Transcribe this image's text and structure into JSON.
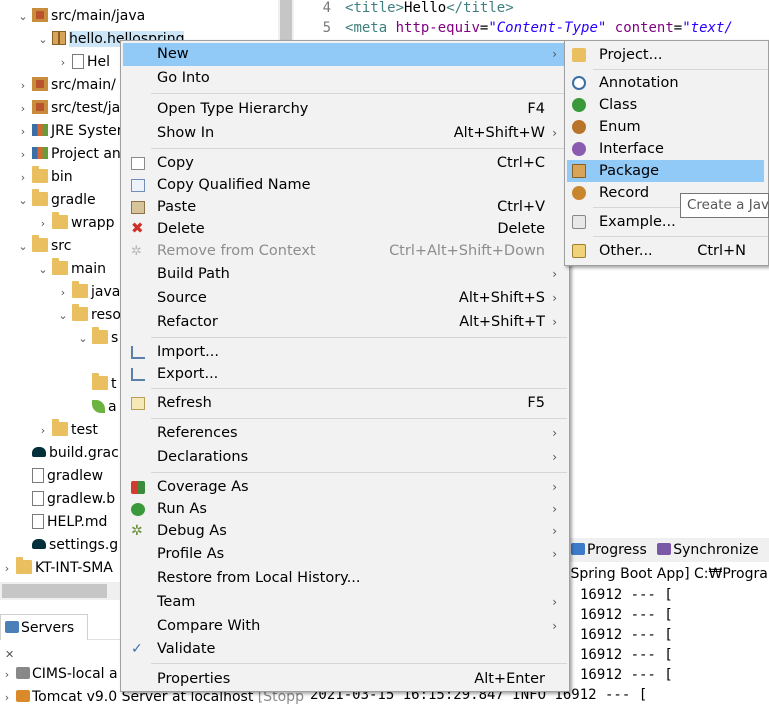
{
  "editor": {
    "lines": [
      {
        "number": "4",
        "open": "<",
        "tag": "title",
        "close": ">",
        "text": "Hello",
        "end": "</title>"
      },
      {
        "number": "5",
        "open": "<",
        "tag": "meta",
        "attr1": "http-equiv",
        "eq1": "=",
        "val1": "\"Content-Type\"",
        "attr2": "content",
        "eq2": "=",
        "val2": "\"text/"
      }
    ]
  },
  "explorer": {
    "rows": [
      {
        "label": "src/main/java",
        "icon": "source-folder-icon"
      },
      {
        "label": "hello.hellospring",
        "icon": "package-icon"
      },
      {
        "label": "Hel",
        "icon": "java-file-icon"
      },
      {
        "label": "src/main/",
        "icon": "source-folder-icon"
      },
      {
        "label": "src/test/ja",
        "icon": "source-folder-icon"
      },
      {
        "label": "JRE Syster",
        "icon": "library-icon"
      },
      {
        "label": "Project an",
        "icon": "library-icon"
      },
      {
        "label": "bin",
        "icon": "folder-icon"
      },
      {
        "label": "gradle",
        "icon": "folder-icon"
      },
      {
        "label": "wrapp",
        "icon": "folder-icon"
      },
      {
        "label": "src",
        "icon": "folder-icon"
      },
      {
        "label": "main",
        "icon": "folder-icon"
      },
      {
        "label": "java",
        "icon": "folder-icon"
      },
      {
        "label": "reso",
        "icon": "folder-icon"
      },
      {
        "label": "s",
        "icon": "folder-icon"
      },
      {
        "label": "t",
        "icon": "folder-icon"
      },
      {
        "label": "a",
        "icon": "spring-leaf-icon"
      },
      {
        "label": "test",
        "icon": "folder-icon"
      },
      {
        "label": "build.grac",
        "icon": "gradle-icon"
      },
      {
        "label": "gradlew",
        "icon": "file-icon"
      },
      {
        "label": "gradlew.b",
        "icon": "file-icon"
      },
      {
        "label": "HELP.md",
        "icon": "markdown-file-icon"
      },
      {
        "label": "settings.g",
        "icon": "gradle-icon"
      },
      {
        "label": "KT-INT-SMA",
        "icon": "project-icon"
      }
    ]
  },
  "servers": {
    "tab_label": "Servers",
    "rows": [
      {
        "label": "CIMS-local a",
        "status": ""
      },
      {
        "label": "Tomcat v9.0 Server at localhost",
        "status": "[Stopp"
      }
    ]
  },
  "console": {
    "tabs": [
      {
        "label": "Progress",
        "icon": "progress-icon"
      },
      {
        "label": "Synchronize",
        "icon": "synchronize-icon"
      }
    ],
    "header": "[Spring Boot App] C:₩Progra",
    "lines": [
      {
        "text": "16912 --- ["
      },
      {
        "text": "16912 --- ["
      },
      {
        "text": "16912 --- ["
      },
      {
        "text": "16912 --- ["
      },
      {
        "text": "16912 --- ["
      },
      {
        "text": "2021-03-15 16:15:29.847  INFO 16912 --- ["
      }
    ]
  },
  "context_menu": {
    "items": [
      {
        "label": "New",
        "shortcut": "",
        "submenu": true,
        "disabled": false,
        "highlighted": true,
        "icon": ""
      },
      {
        "label": "Go Into",
        "shortcut": "",
        "submenu": false,
        "disabled": false,
        "icon": ""
      },
      {
        "label": "Open Type Hierarchy",
        "shortcut": "F4",
        "submenu": false,
        "disabled": false,
        "icon": ""
      },
      {
        "label": "Show In",
        "shortcut": "Alt+Shift+W",
        "submenu": true,
        "disabled": false,
        "icon": ""
      },
      {
        "label": "Copy",
        "shortcut": "Ctrl+C",
        "submenu": false,
        "disabled": false,
        "icon": "copy-icon"
      },
      {
        "label": "Copy Qualified Name",
        "shortcut": "",
        "submenu": false,
        "disabled": false,
        "icon": "copy-qualified-name-icon"
      },
      {
        "label": "Paste",
        "shortcut": "Ctrl+V",
        "submenu": false,
        "disabled": false,
        "icon": "paste-icon"
      },
      {
        "label": "Delete",
        "shortcut": "Delete",
        "submenu": false,
        "disabled": false,
        "icon": "delete-icon"
      },
      {
        "label": "Remove from Context",
        "shortcut": "Ctrl+Alt+Shift+Down",
        "submenu": false,
        "disabled": true,
        "icon": "remove-from-context-icon"
      },
      {
        "label": "Build Path",
        "shortcut": "",
        "submenu": true,
        "disabled": false,
        "icon": ""
      },
      {
        "label": "Source",
        "shortcut": "Alt+Shift+S",
        "submenu": true,
        "disabled": false,
        "icon": ""
      },
      {
        "label": "Refactor",
        "shortcut": "Alt+Shift+T",
        "submenu": true,
        "disabled": false,
        "icon": ""
      },
      {
        "label": "Import...",
        "shortcut": "",
        "submenu": false,
        "disabled": false,
        "icon": "import-icon"
      },
      {
        "label": "Export...",
        "shortcut": "",
        "submenu": false,
        "disabled": false,
        "icon": "export-icon"
      },
      {
        "label": "Refresh",
        "shortcut": "F5",
        "submenu": false,
        "disabled": false,
        "icon": "refresh-icon"
      },
      {
        "label": "References",
        "shortcut": "",
        "submenu": true,
        "disabled": false,
        "icon": ""
      },
      {
        "label": "Declarations",
        "shortcut": "",
        "submenu": true,
        "disabled": false,
        "icon": ""
      },
      {
        "label": "Coverage As",
        "shortcut": "",
        "submenu": true,
        "disabled": false,
        "icon": "coverage-icon"
      },
      {
        "label": "Run As",
        "shortcut": "",
        "submenu": true,
        "disabled": false,
        "icon": "run-icon"
      },
      {
        "label": "Debug As",
        "shortcut": "",
        "submenu": true,
        "disabled": false,
        "icon": "debug-bug-icon"
      },
      {
        "label": "Profile As",
        "shortcut": "",
        "submenu": true,
        "disabled": false,
        "icon": ""
      },
      {
        "label": "Restore from Local History...",
        "shortcut": "",
        "submenu": false,
        "disabled": false,
        "icon": ""
      },
      {
        "label": "Team",
        "shortcut": "",
        "submenu": true,
        "disabled": false,
        "icon": ""
      },
      {
        "label": "Compare With",
        "shortcut": "",
        "submenu": true,
        "disabled": false,
        "icon": ""
      },
      {
        "label": "Validate",
        "shortcut": "",
        "submenu": false,
        "disabled": false,
        "icon": "checkmark-icon"
      },
      {
        "label": "Properties",
        "shortcut": "Alt+Enter",
        "submenu": false,
        "disabled": false,
        "icon": ""
      }
    ]
  },
  "new_submenu": {
    "items": [
      {
        "label": "Project...",
        "shortcut": "",
        "icon": "new-project-icon",
        "highlighted": false
      },
      {
        "label": "Annotation",
        "shortcut": "",
        "icon": "annotation-icon",
        "highlighted": false
      },
      {
        "label": "Class",
        "shortcut": "",
        "icon": "class-icon",
        "highlighted": false
      },
      {
        "label": "Enum",
        "shortcut": "",
        "icon": "enum-icon",
        "highlighted": false
      },
      {
        "label": "Interface",
        "shortcut": "",
        "icon": "interface-icon",
        "highlighted": false
      },
      {
        "label": "Package",
        "shortcut": "",
        "icon": "package-icon",
        "highlighted": true
      },
      {
        "label": "Record",
        "shortcut": "",
        "icon": "record-icon",
        "highlighted": false
      },
      {
        "label": "Example...",
        "shortcut": "",
        "icon": "example-icon",
        "highlighted": false
      },
      {
        "label": "Other...",
        "shortcut": "Ctrl+N",
        "icon": "other-wizard-icon",
        "highlighted": false
      }
    ]
  },
  "tooltip": {
    "text": "Create a Jav"
  },
  "colors": {
    "menu_highlight": "#91c9f7",
    "menu_background": "#f2f2f2",
    "tree_selection": "#cde6f7",
    "disabled_text": "#8d8d8d",
    "xml_tag": "#3f7f7f",
    "xml_attr": "#7f007f",
    "xml_value": "#2a00ff"
  }
}
